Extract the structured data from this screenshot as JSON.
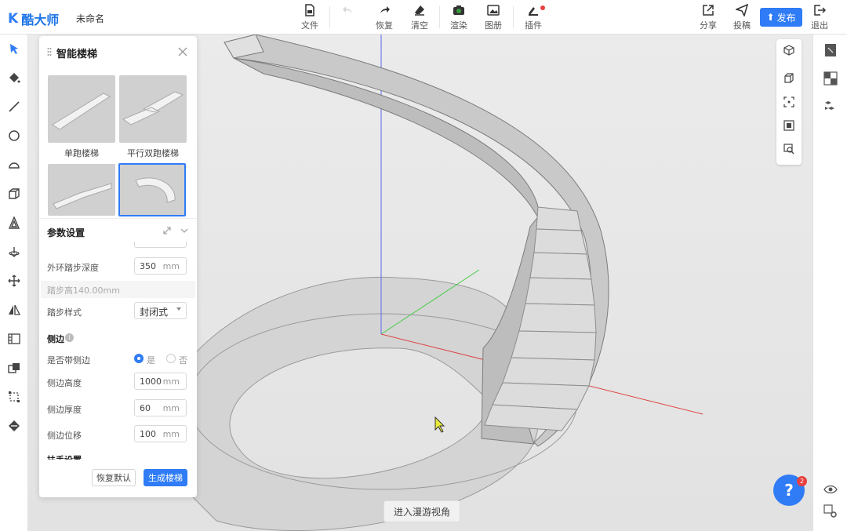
{
  "app": {
    "logo_text": "酷大师",
    "doc_title": "未命名"
  },
  "toolbar": {
    "file": "文件",
    "undo": "",
    "redo": "恢复",
    "clear": "清空",
    "render": "渲染",
    "gallery": "图册",
    "plugins": "插件",
    "share": "分享",
    "submit": "投稿",
    "publish": "发布",
    "exit": "退出"
  },
  "panel": {
    "title": "智能楼梯",
    "templates": [
      {
        "label": "单跑楼梯"
      },
      {
        "label": "平行双跑楼梯"
      },
      {
        "label": ""
      },
      {
        "label": ""
      }
    ],
    "params_title": "参数设置",
    "outer_depth": {
      "label": "外环踏步深度",
      "value": "350",
      "unit": "mm"
    },
    "step_height_hint": "踏步高140.00mm",
    "step_style": {
      "label": "踏步样式",
      "value": "封闭式"
    },
    "side_section": "侧边",
    "has_side": {
      "label": "是否带侧边",
      "yes": "是",
      "no": "否",
      "selected": "是"
    },
    "side_height": {
      "label": "侧边高度",
      "value": "1000",
      "unit": "mm"
    },
    "side_thickness": {
      "label": "侧边厚度",
      "value": "60",
      "unit": "mm"
    },
    "side_offset": {
      "label": "侧边位移",
      "value": "100",
      "unit": "mm"
    },
    "handrail_section": "扶手设置",
    "reset_button": "恢复默认",
    "generate_button": "生成楼梯"
  },
  "viewport": {
    "roam_button": "进入漫游视角"
  },
  "help": {
    "label": "?",
    "badge": "2"
  },
  "colors": {
    "accent": "#2f7cf6",
    "badge": "#e84040"
  }
}
